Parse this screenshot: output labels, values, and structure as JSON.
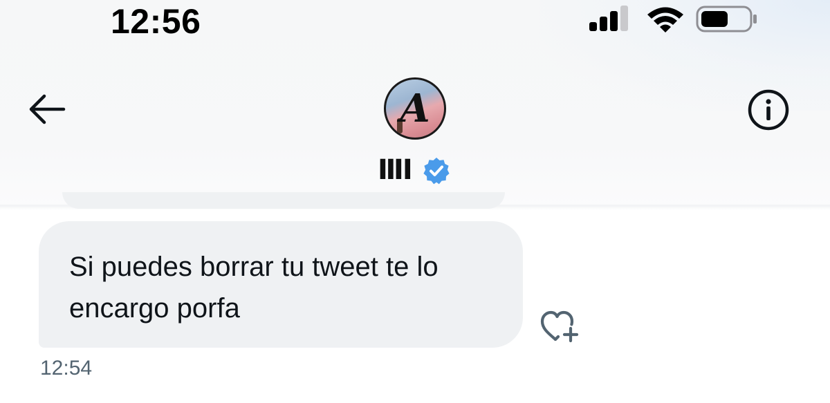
{
  "status_bar": {
    "time": "12:56",
    "signal_icon": "cellular-signal-icon",
    "wifi_icon": "wifi-icon",
    "battery_icon": "battery-icon"
  },
  "header": {
    "back_icon": "arrow-left-icon",
    "info_icon": "info-circle-icon",
    "avatar_letter": "A",
    "display_name": "ⅢⅠ",
    "verified_icon": "verified-badge-icon"
  },
  "colors": {
    "accent_blue": "#1d9bf0",
    "verified_blue": "#4a9bea",
    "bubble_bg": "#eff1f3",
    "text_primary": "#0f1419",
    "text_secondary": "#536471"
  },
  "conversation": {
    "messages": [
      {
        "text": "Si puedes borrar tu tweet te lo encargo porfa",
        "time": "12:54",
        "reaction_icon": "heart-plus-icon"
      }
    ]
  }
}
